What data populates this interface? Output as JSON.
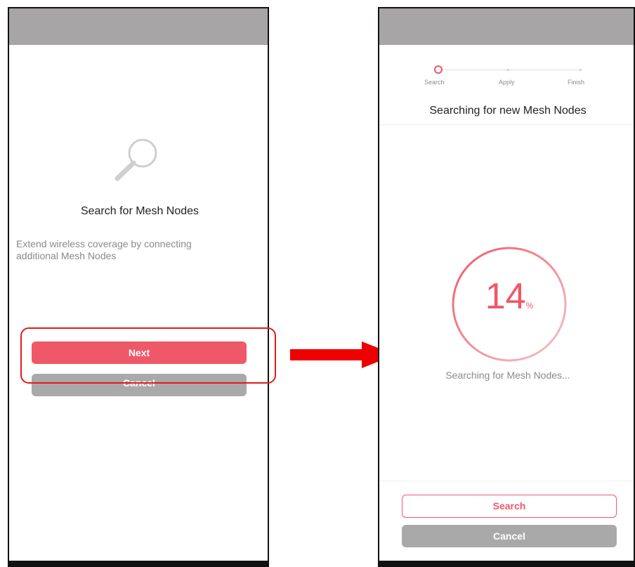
{
  "colors": {
    "accent": "#ef5868",
    "statusbar": "#a8a5a6",
    "cancel_bg": "#a9a9a9",
    "arrow": "#ee0000",
    "highlight": "#e11b1b"
  },
  "left_screen": {
    "icon": "search-magnifier-icon",
    "title": "Search for Mesh Nodes",
    "description": "Extend wireless coverage by connecting additional Mesh Nodes",
    "next_label": "Next",
    "cancel_label": "Cancel"
  },
  "right_screen": {
    "steps": [
      "Search",
      "Apply",
      "Finish"
    ],
    "title": "Searching for new Mesh Nodes",
    "progress_value": "14",
    "progress_unit": "%",
    "progress_fraction": 0.14,
    "status_text": "Searching for Mesh Nodes...",
    "search_label": "Search",
    "cancel_label": "Cancel"
  }
}
